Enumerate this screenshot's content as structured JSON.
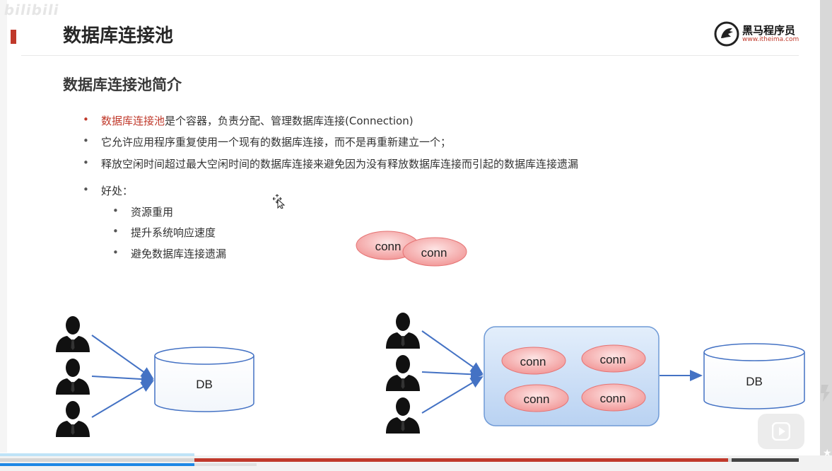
{
  "page": {
    "title": "数据库连接池",
    "section_title": "数据库连接池简介"
  },
  "brand": {
    "name": "黑马程序员",
    "url": "www.itheima.com"
  },
  "bullets": {
    "item1_highlight": "数据库连接池",
    "item1_rest": "是个容器，负责分配、管理数据库连接(Connection)",
    "item2": "它允许应用程序重复使用一个现有的数据库连接，而不是再重新建立一个；",
    "item3": "释放空闲时间超过最大空闲时间的数据库连接来避免因为没有释放数据库连接而引起的数据库连接遗漏",
    "item4": "好处："
  },
  "benefits": [
    "资源重用",
    "提升系统响应速度",
    "避免数据库连接遗漏"
  ],
  "diagram": {
    "db_label": "DB",
    "conn_label": "conn"
  },
  "player": {
    "watermark": "bilibili",
    "played_fraction": 0.234
  },
  "colors": {
    "accent_red": "#c0392b",
    "pool_blue": "#c9dcf5",
    "arrow_blue": "#4472c4",
    "conn_pink": "#f4a3a3"
  },
  "icons": [
    "person-icon",
    "database-icon",
    "cursor-move-icon",
    "play-icon",
    "star-icon",
    "brand-logo-icon"
  ]
}
